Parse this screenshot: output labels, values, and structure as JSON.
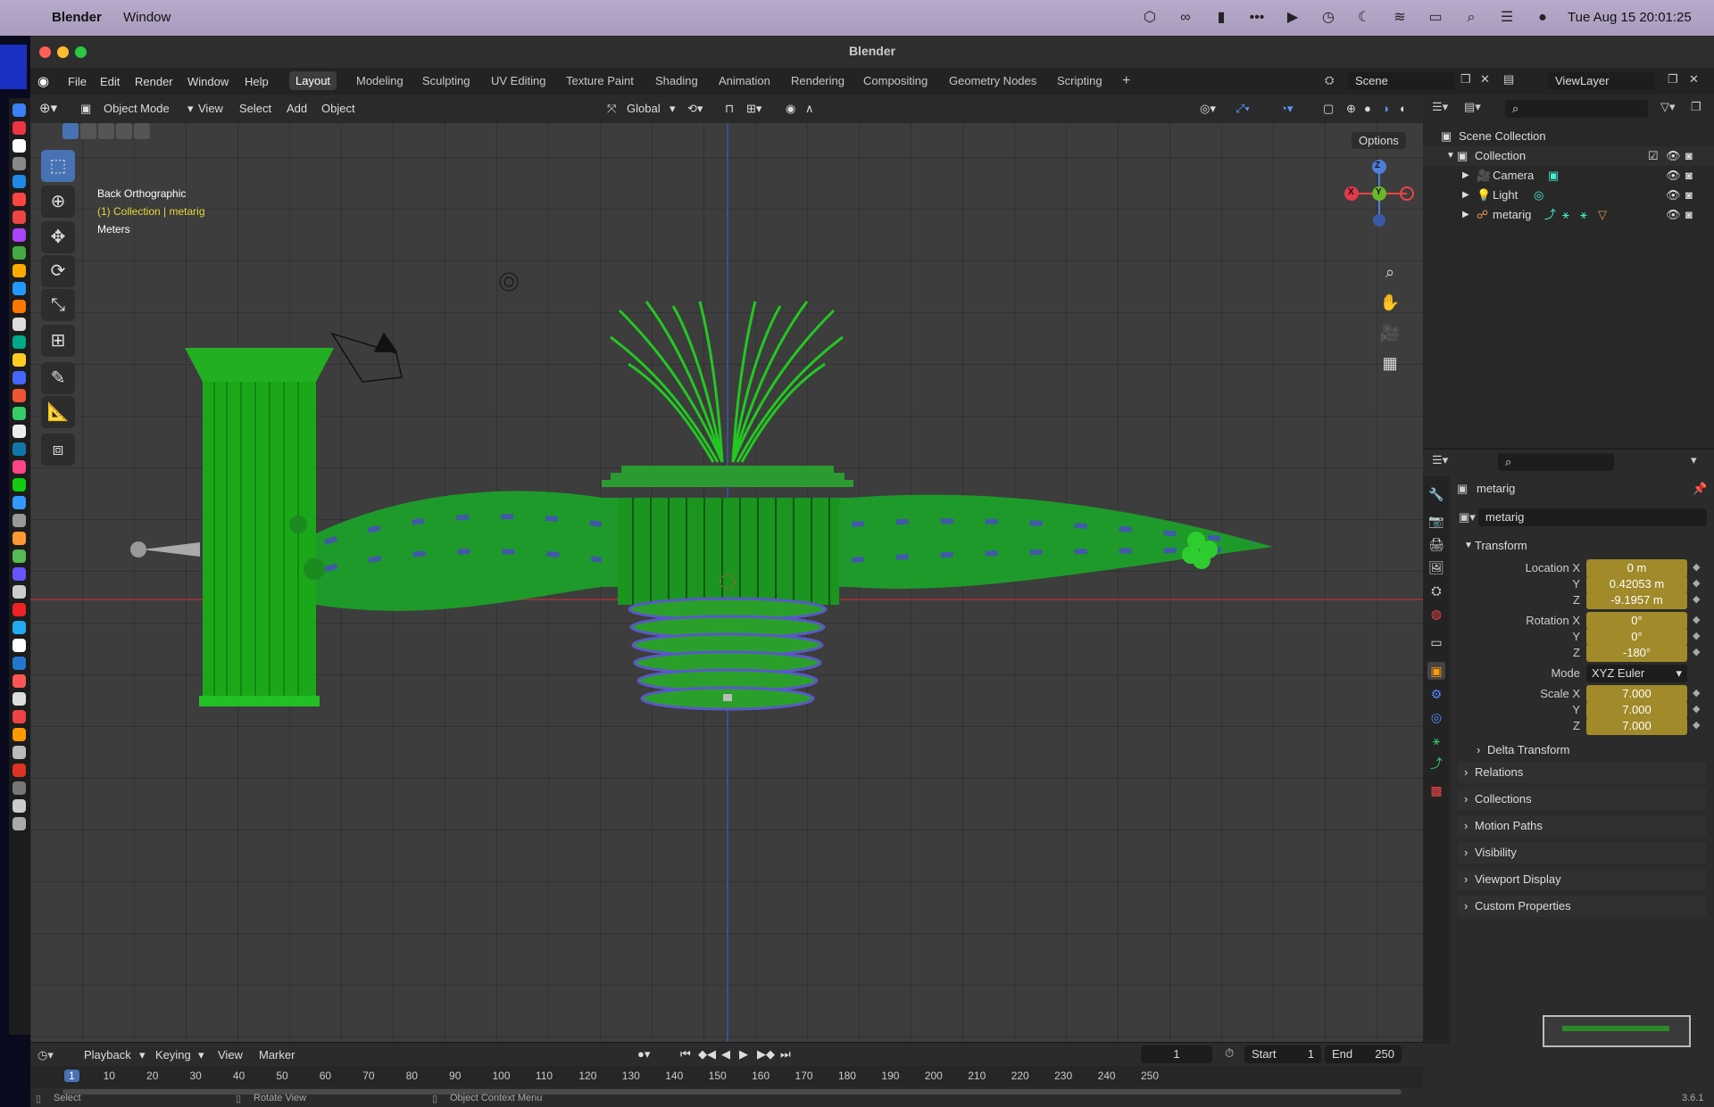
{
  "mac": {
    "app": "Blender",
    "window_menu": "Window",
    "clock": "Tue Aug 15  20:01:25"
  },
  "window": {
    "title": "Blender"
  },
  "menus": [
    "File",
    "Edit",
    "Render",
    "Window",
    "Help"
  ],
  "workspaces": [
    "Layout",
    "Modeling",
    "Sculpting",
    "UV Editing",
    "Texture Paint",
    "Shading",
    "Animation",
    "Rendering",
    "Compositing",
    "Geometry Nodes",
    "Scripting"
  ],
  "active_workspace": "Layout",
  "scene_field": "Scene",
  "viewlayer_field": "ViewLayer",
  "viewport_header": {
    "mode": "Object Mode",
    "menus": [
      "View",
      "Select",
      "Add",
      "Object"
    ],
    "orientation": "Global",
    "options": "Options"
  },
  "viewport_info": {
    "view_name": "Back Orthographic",
    "collection": "(1) Collection | metarig",
    "units": "Meters"
  },
  "gizmo": {
    "z": "Z",
    "y": "Y",
    "x": "X"
  },
  "outliner": {
    "root": "Scene Collection",
    "collection": "Collection",
    "items": [
      "Camera",
      "Light",
      "metarig"
    ]
  },
  "properties": {
    "object_name": "metarig",
    "data_name": "metarig",
    "transform_title": "Transform",
    "location_label": "Location X",
    "location": [
      "0 m",
      "0.42053 m",
      "-9.1957 m"
    ],
    "rotation_label": "Rotation X",
    "rotation": [
      "0°",
      "0°",
      "-180°"
    ],
    "axis_labels": [
      "Y",
      "Z"
    ],
    "mode_label": "Mode",
    "mode_value": "XYZ Euler",
    "scale_label": "Scale X",
    "scale": [
      "7.000",
      "7.000",
      "7.000"
    ],
    "delta": "Delta Transform",
    "sections": [
      "Relations",
      "Collections",
      "Motion Paths",
      "Visibility",
      "Viewport Display",
      "Custom Properties"
    ]
  },
  "timeline": {
    "menus": [
      "Playback",
      "Keying",
      "View",
      "Marker"
    ],
    "current_frame": "1",
    "start_label": "Start",
    "start": "1",
    "end_label": "End",
    "end": "250",
    "ticks": [
      "1",
      "10",
      "20",
      "30",
      "40",
      "50",
      "60",
      "70",
      "80",
      "90",
      "100",
      "110",
      "120",
      "130",
      "140",
      "150",
      "160",
      "170",
      "180",
      "190",
      "200",
      "210",
      "220",
      "230",
      "240",
      "250"
    ]
  },
  "status": {
    "select": "Select",
    "rotate": "Rotate View",
    "context": "Object Context Menu",
    "version": "3.6.1"
  }
}
